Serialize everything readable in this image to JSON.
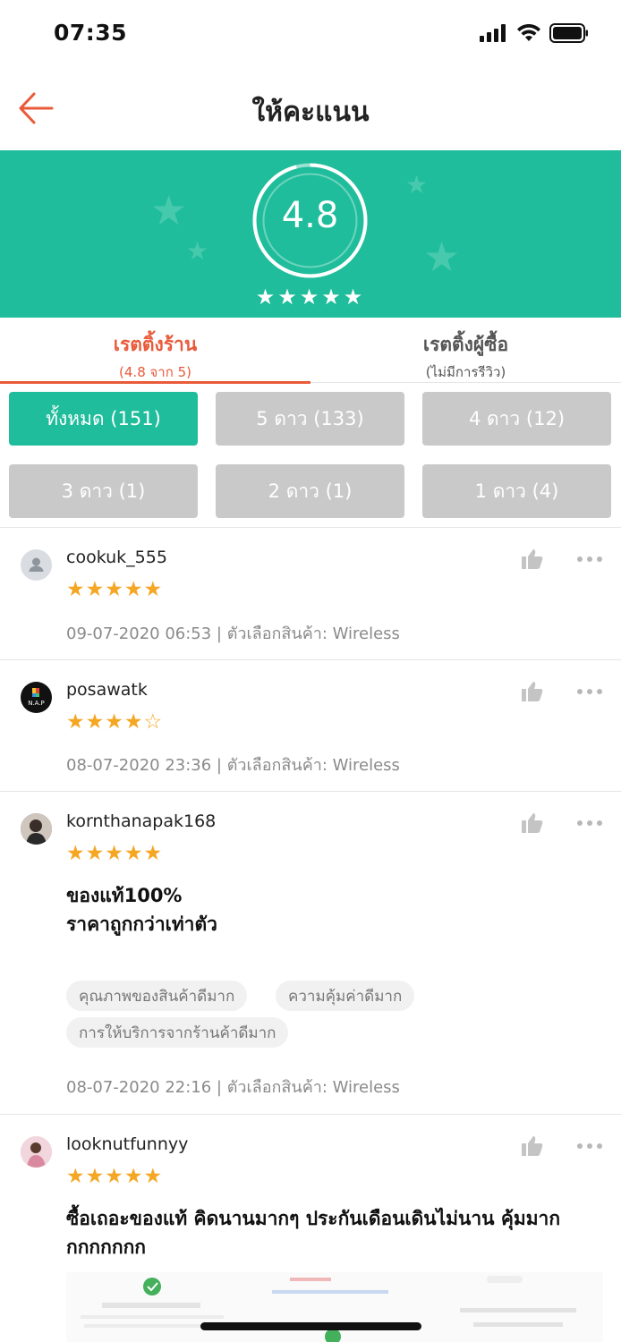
{
  "status_bar": {
    "time": "07:35"
  },
  "header": {
    "title": "ให้คะแนน"
  },
  "rating": {
    "score": "4.8",
    "stars": "★★★★★",
    "stars_count": 5
  },
  "tabs": [
    {
      "title": "เรตติ้งร้าน",
      "subtitle": "(4.8 จาก 5)"
    },
    {
      "title": "เรตติ้งผู้ซื้อ",
      "subtitle": "(ไม่มีการรีวิว)"
    }
  ],
  "filters": [
    {
      "label": "ทั้งหมด (151)"
    },
    {
      "label": "5 ดาว (133)"
    },
    {
      "label": "4 ดาว (12)"
    },
    {
      "label": "3 ดาว (1)"
    },
    {
      "label": "2 ดาว (1)"
    },
    {
      "label": "1 ดาว (4)"
    }
  ],
  "reviews": [
    {
      "username": "cookuk_555",
      "stars": "★★★★★",
      "rating": 5,
      "meta": "09-07-2020 06:53 | ตัวเลือกสินค้า: Wireless"
    },
    {
      "username": "posawatk",
      "stars": "★★★★",
      "stars_empty": "☆",
      "rating": 4,
      "avatar_text": "N.A.P",
      "meta": "08-07-2020 23:36 | ตัวเลือกสินค้า: Wireless"
    },
    {
      "username": "kornthanapak168",
      "stars": "★★★★★",
      "rating": 5,
      "comment_line1": "ของแท้100%",
      "comment_line2": "ราคาถูกกว่าเท่าตัว",
      "tags": [
        "คุณภาพของสินค้าดีมาก",
        "ความคุ้มค่าดีมาก",
        "การให้บริการจากร้านค้าดีมาก"
      ],
      "meta": "08-07-2020 22:16 | ตัวเลือกสินค้า: Wireless"
    },
    {
      "username": "looknutfunnyy",
      "stars": "★★★★★",
      "rating": 5,
      "comment_line1": "ซื้อเถอะของแท้ คิดนานมากๆ ประกันเดือนเดินไม่นาน คุ้มมาก",
      "comment_line2": "กกกกกกก"
    }
  ],
  "colors": {
    "accent": "#1fbd9b",
    "active_tab": "#e95a3a",
    "star": "#f5a623",
    "filter_inactive": "#c9c9c9"
  }
}
